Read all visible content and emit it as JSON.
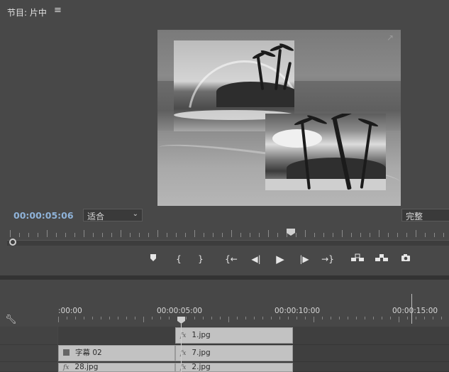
{
  "monitor": {
    "title": "节目: 片中",
    "menu_icon": "hamburger-menu-icon",
    "timecode": "00:00:05:06",
    "fit_value": "适合",
    "quality_value": "完整"
  },
  "transport": [
    {
      "name": "add-marker",
      "icon": "marker-icon"
    },
    {
      "name": "mark-in",
      "icon": "mark-in-icon"
    },
    {
      "name": "mark-out",
      "icon": "mark-out-icon"
    },
    {
      "name": "go-to-in",
      "icon": "go-to-in-icon"
    },
    {
      "name": "step-back",
      "icon": "step-back-icon"
    },
    {
      "name": "play",
      "icon": "play-icon"
    },
    {
      "name": "step-forward",
      "icon": "step-forward-icon"
    },
    {
      "name": "go-to-out",
      "icon": "go-to-out-icon"
    },
    {
      "name": "lift",
      "icon": "lift-icon"
    },
    {
      "name": "extract",
      "icon": "extract-icon"
    },
    {
      "name": "export-frame",
      "icon": "camera-icon"
    }
  ],
  "timeline": {
    "times": [
      ":00:00",
      "00:00:05:00",
      "00:00:10:00",
      "00:00:15:00"
    ],
    "clips": {
      "c1": {
        "label": "1.jpg",
        "fx": "fx"
      },
      "c2": {
        "label": "字幕 02",
        "badge": "title-icon"
      },
      "c3": {
        "label": "7.jpg",
        "fx": "fx"
      },
      "c4": {
        "label": "28.jpg",
        "fx": "fx"
      },
      "c5": {
        "label": "2.jpg",
        "fx": "fx"
      }
    }
  },
  "colors": {
    "timecode": "#8fb3d9",
    "clip": "#c2c2c2",
    "panel": "#484848"
  }
}
